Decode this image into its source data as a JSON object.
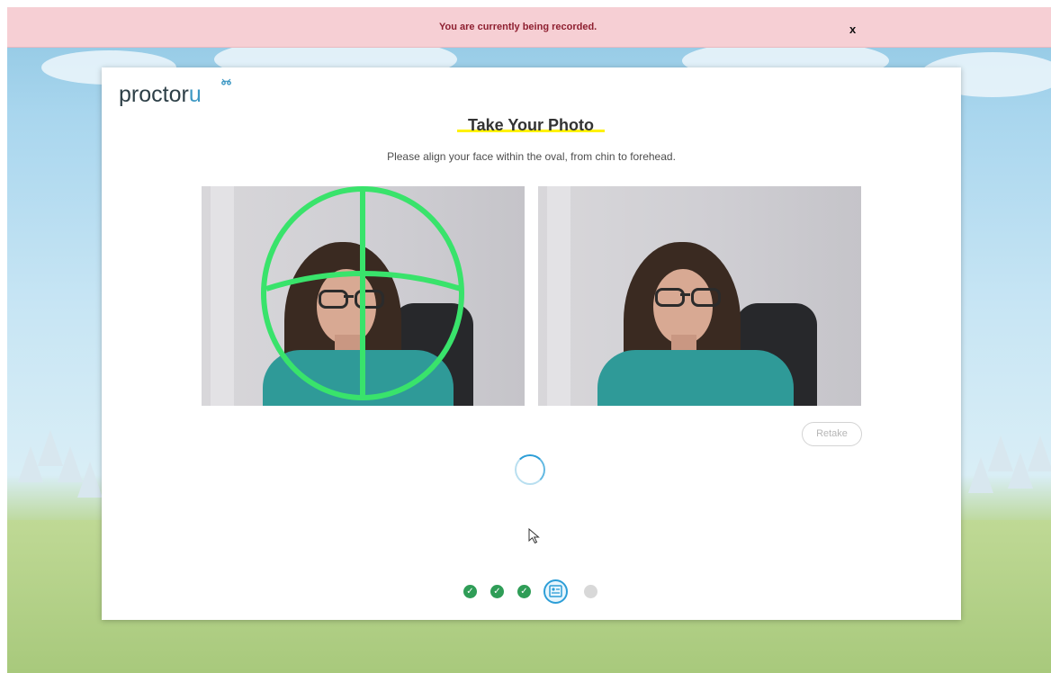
{
  "banner": {
    "text": "You are currently being recorded.",
    "close_label": "x"
  },
  "brand": {
    "logo_text_main": "proctor",
    "logo_text_accent": "u",
    "owl_icon": "owl-icon"
  },
  "page": {
    "title": "Take Your Photo",
    "instruction": "Please align your face within the oval, from chin to forehead."
  },
  "camera": {
    "live_feed_icon": "webcam-feed-icon",
    "captured_photo_icon": "captured-photo-icon",
    "overlay_color": "#39e36b"
  },
  "actions": {
    "retake_label": "Retake"
  },
  "progress": {
    "completed_steps": 3,
    "current_step": 4,
    "total_steps": 5,
    "current_step_icon": "id-card-icon",
    "completed_color": "#2f9d57",
    "accent_color": "#2d9ed7"
  },
  "colors": {
    "banner_bg": "#f6cfd4",
    "banner_text": "#8e1f30",
    "title_highlight": "#fff200"
  }
}
